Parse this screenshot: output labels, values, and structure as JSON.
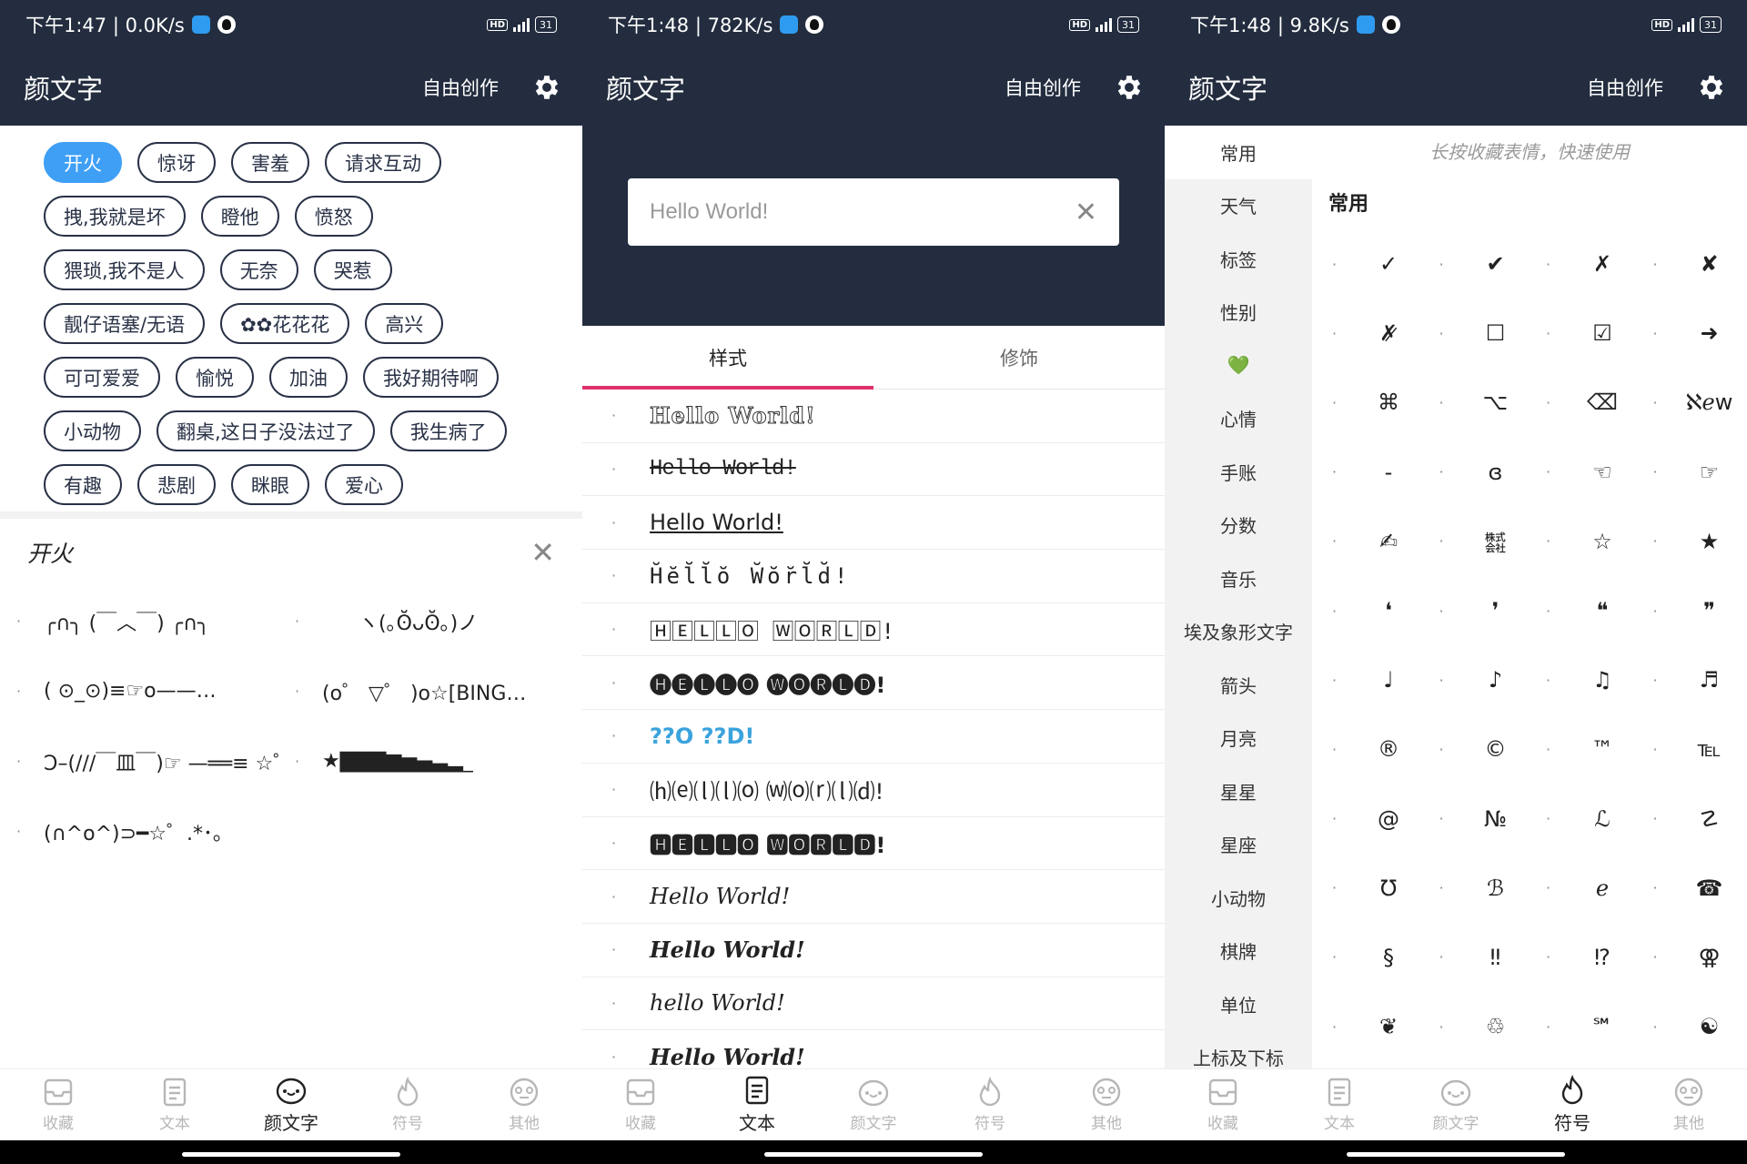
{
  "screens": [
    {
      "status": {
        "time": "下午1:47 | 0.0K/s",
        "battery": "31"
      },
      "appbar": {
        "title": "颜文字",
        "action": "自由创作"
      },
      "tags": [
        "开火",
        "惊讶",
        "害羞",
        "请求互动",
        "拽,我就是坏",
        "瞪他",
        "愤怒",
        "猥琐,我不是人",
        "无奈",
        "哭惹",
        "靓仔语塞/无语",
        "✿✿花花花",
        "高兴",
        "可可爱爱",
        "愉悦",
        "加油",
        "我好期待啊",
        "小动物",
        "翻桌,这日子没法过了",
        "我生病了",
        "有趣",
        "悲剧",
        "眯眼",
        "爱心"
      ],
      "panel": {
        "title": "开火",
        "items": [
          "╭∩╮ (￣︿￣) ╭∩╮",
          "ヽ(｡ʘ̆̆ᴗʘ̆̆｡)ノ",
          "( ⊙_⊙)≡☞o——…",
          "(o゜ ▽゜ )o☆[BING…",
          "Ↄ–(///￣皿￣)☞ —══≡ ☆゜",
          "★▇▇▇▆▅▄▃▂_",
          "(∩^o^)⊃━☆゜.*･｡"
        ]
      }
    },
    {
      "status": {
        "time": "下午1:48 | 782K/s",
        "battery": "31"
      },
      "appbar": {
        "title": "颜文字",
        "action": "自由创作"
      },
      "input": {
        "value": "Hello World!"
      },
      "tabs": [
        "样式",
        "修饰"
      ],
      "styles": [
        "Hello World!",
        "Hello World!",
        "Hello World!",
        "H̆ĕl̆l̆ŏ W̆ŏr̆l̆d̆!",
        "🄷🄴🄻🄻🄾 🅆🄾🅁🄻🄳!",
        "🅗🅔🅛🅛🅞 🅦🅞🅡🅛🅓!",
        "??O ??D!",
        "⒣⒠⒧⒧⒪ ⒲⒪⒭⒧⒟!",
        "🅷🅴🅻🅻🅾 🆆🅾🆁🅻🅳!",
        "Hello World!",
        "Hello World!",
        "hello World!",
        "Hello World!"
      ]
    },
    {
      "status": {
        "time": "下午1:48 | 9.8K/s",
        "battery": "31"
      },
      "appbar": {
        "title": "颜文字",
        "action": "自由创作"
      },
      "categories": [
        "常用",
        "天气",
        "标签",
        "性别",
        "💚",
        "心情",
        "手账",
        "分数",
        "音乐",
        "埃及象形文字",
        "箭头",
        "月亮",
        "星星",
        "星座",
        "小动物",
        "棋牌",
        "单位",
        "上标及下标"
      ],
      "hint": "长按收藏表情，快速使用",
      "section_title": "常用",
      "symbols": [
        "✓",
        "✔",
        "✗",
        "✘",
        "✗̷",
        "☐",
        "☑",
        "➜",
        "⌘",
        "⌥",
        "⌫",
        "ℵℯw",
        "-",
        "ɞ",
        "☜",
        "☞",
        "✍",
        "㍿",
        "☆",
        "★",
        "❛",
        "❜",
        "❝",
        "❞",
        "♩",
        "♪",
        "♫",
        "♬",
        "®",
        "©",
        "™",
        "℡",
        "@",
        "№",
        "ℒ",
        "☡",
        "℧",
        "ℬ",
        "ℯ",
        "☎",
        "§",
        "‼",
        "⁉",
        "⚢",
        "❦",
        "♲",
        "℠",
        "☯"
      ]
    }
  ],
  "nav": [
    "收藏",
    "文本",
    "颜文字",
    "符号",
    "其他"
  ],
  "colors": {
    "appbar": "#232d3f",
    "accent_tag": "#3e9ff5",
    "tab_indicator": "#e0306a"
  }
}
